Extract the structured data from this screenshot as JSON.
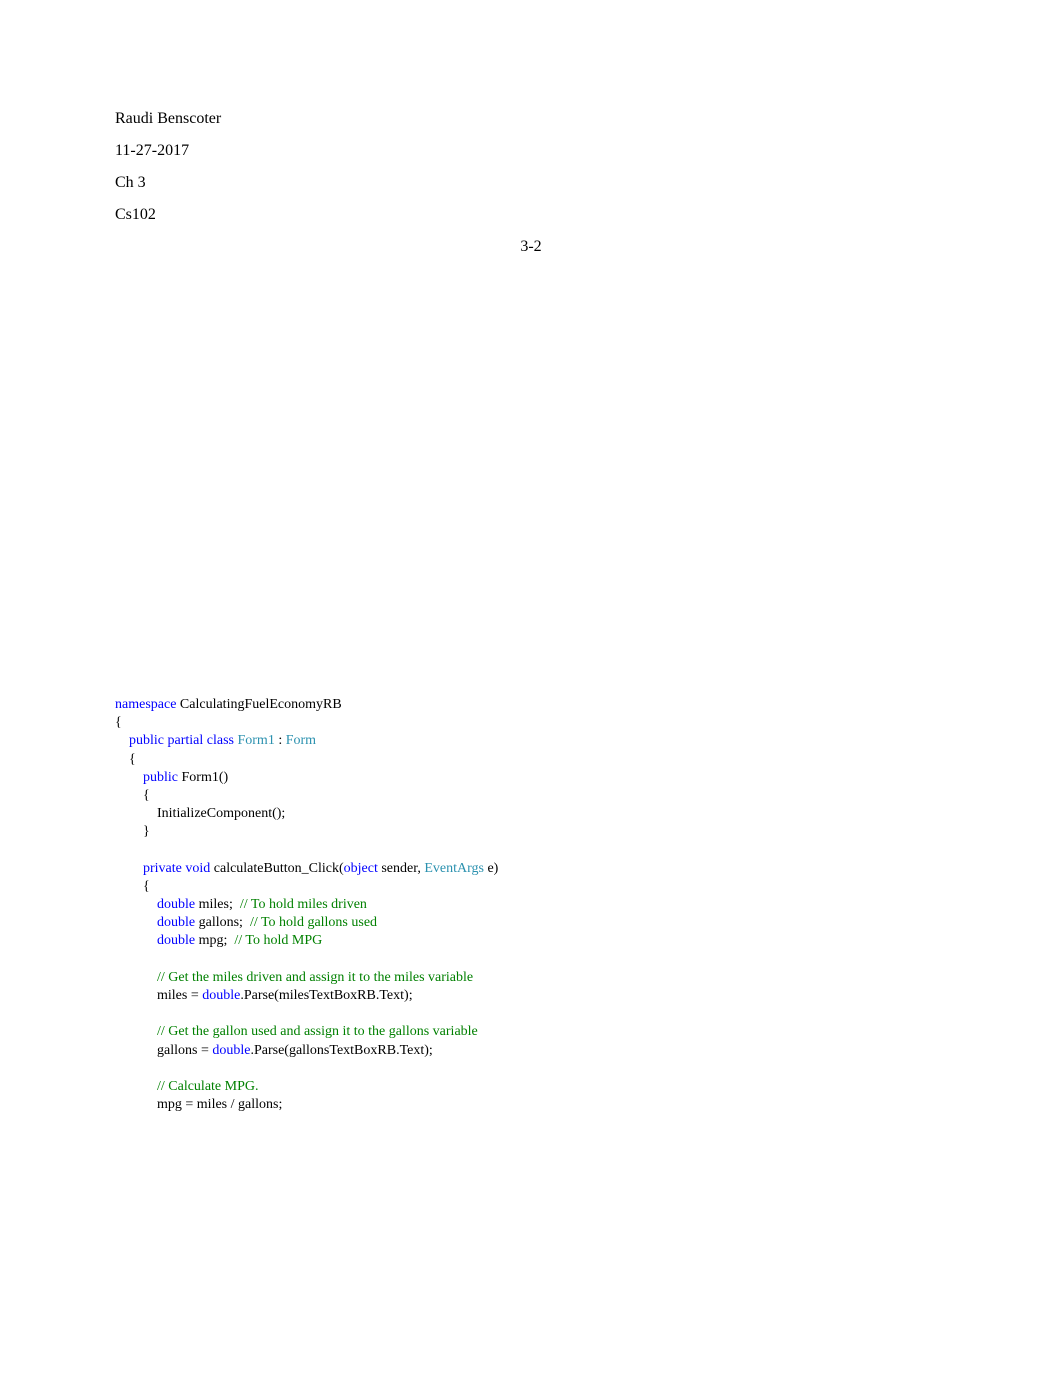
{
  "header": {
    "author": "Raudi Benscoter",
    "date": "11-27-2017",
    "chapter": "Ch 3",
    "course": "Cs102",
    "title": "3-2"
  },
  "code": {
    "namespace_kw": "namespace",
    "namespace_name": " CalculatingFuelEconomyRB",
    "brace_open": "{",
    "class_indent": "    ",
    "public_kw": "public",
    "partial_kw": "partial",
    "class_kw": "class",
    "class_space": " ",
    "class_name": "Form1",
    "colon": " : ",
    "base_class": "Form",
    "class_brace_open": "    {",
    "ctor_indent": "        ",
    "ctor_public": "public",
    "ctor_name": " Form1()",
    "ctor_brace_open": "        {",
    "init_call": "            InitializeComponent();",
    "ctor_brace_close": "        }",
    "method_indent": "        ",
    "private_kw": "private",
    "void_kw": "void",
    "method_name": " calculateButton_Click(",
    "object_kw": "object",
    "sender_param": " sender, ",
    "eventargs_type": "EventArgs",
    "e_param": " e)",
    "method_brace_open": "        {",
    "body_indent": "            ",
    "double_kw": "double",
    "miles_decl": " miles;  ",
    "miles_comment": "// To hold miles driven",
    "gallons_decl": " gallons;  ",
    "gallons_comment": "// To hold gallons used",
    "mpg_decl": " mpg;  ",
    "mpg_comment": "// To hold MPG",
    "get_miles_comment": "// Get the miles driven and assign it to the miles variable",
    "miles_assign_pre": "miles = ",
    "parse_miles": ".Parse(milesTextBoxRB.Text);",
    "get_gallons_comment": "// Get the gallon used and assign it to the gallons variable",
    "gallons_assign_pre": "gallons = ",
    "parse_gallons": ".Parse(gallonsTextBoxRB.Text);",
    "calc_mpg_comment": "// Calculate MPG.",
    "calc_mpg_line": "mpg = miles / gallons;"
  }
}
